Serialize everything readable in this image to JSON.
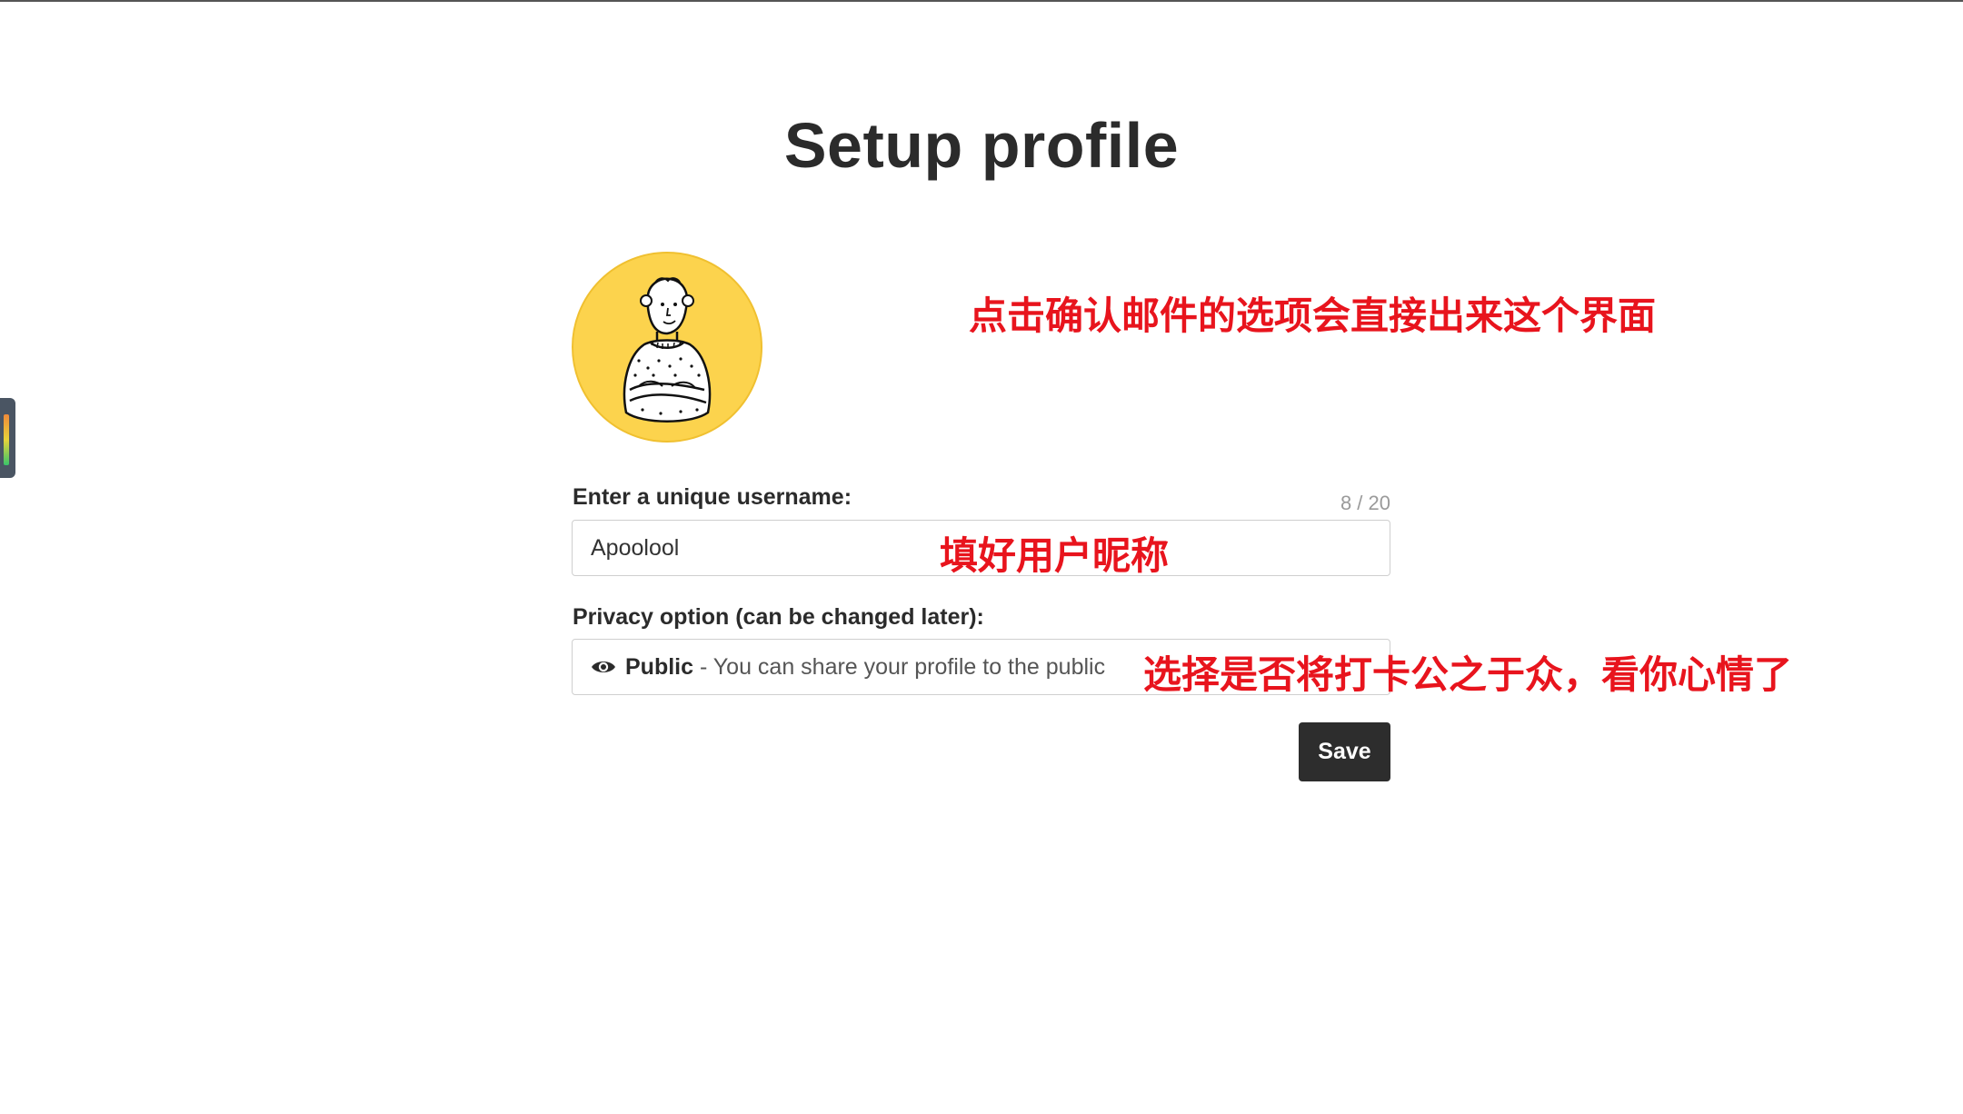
{
  "page": {
    "title": "Setup profile"
  },
  "avatar": {
    "icon": "avatar-illustration",
    "bg_color": "#fcd34d"
  },
  "username": {
    "label": "Enter a unique username:",
    "value": "Apoolool",
    "counter": "8 / 20"
  },
  "privacy": {
    "label": "Privacy option (can be changed later):",
    "icon": "eye-icon",
    "option_name": "Public",
    "option_desc": " - You can share your profile to the public"
  },
  "actions": {
    "save_label": "Save",
    "save_color": "#2d2d2d"
  },
  "annotations": {
    "top": "点击确认邮件的选项会直接出来这个界面",
    "username": "填好用户昵称",
    "privacy": "选择是否将打卡公之于众，看你心情了",
    "color": "#e8141d"
  }
}
